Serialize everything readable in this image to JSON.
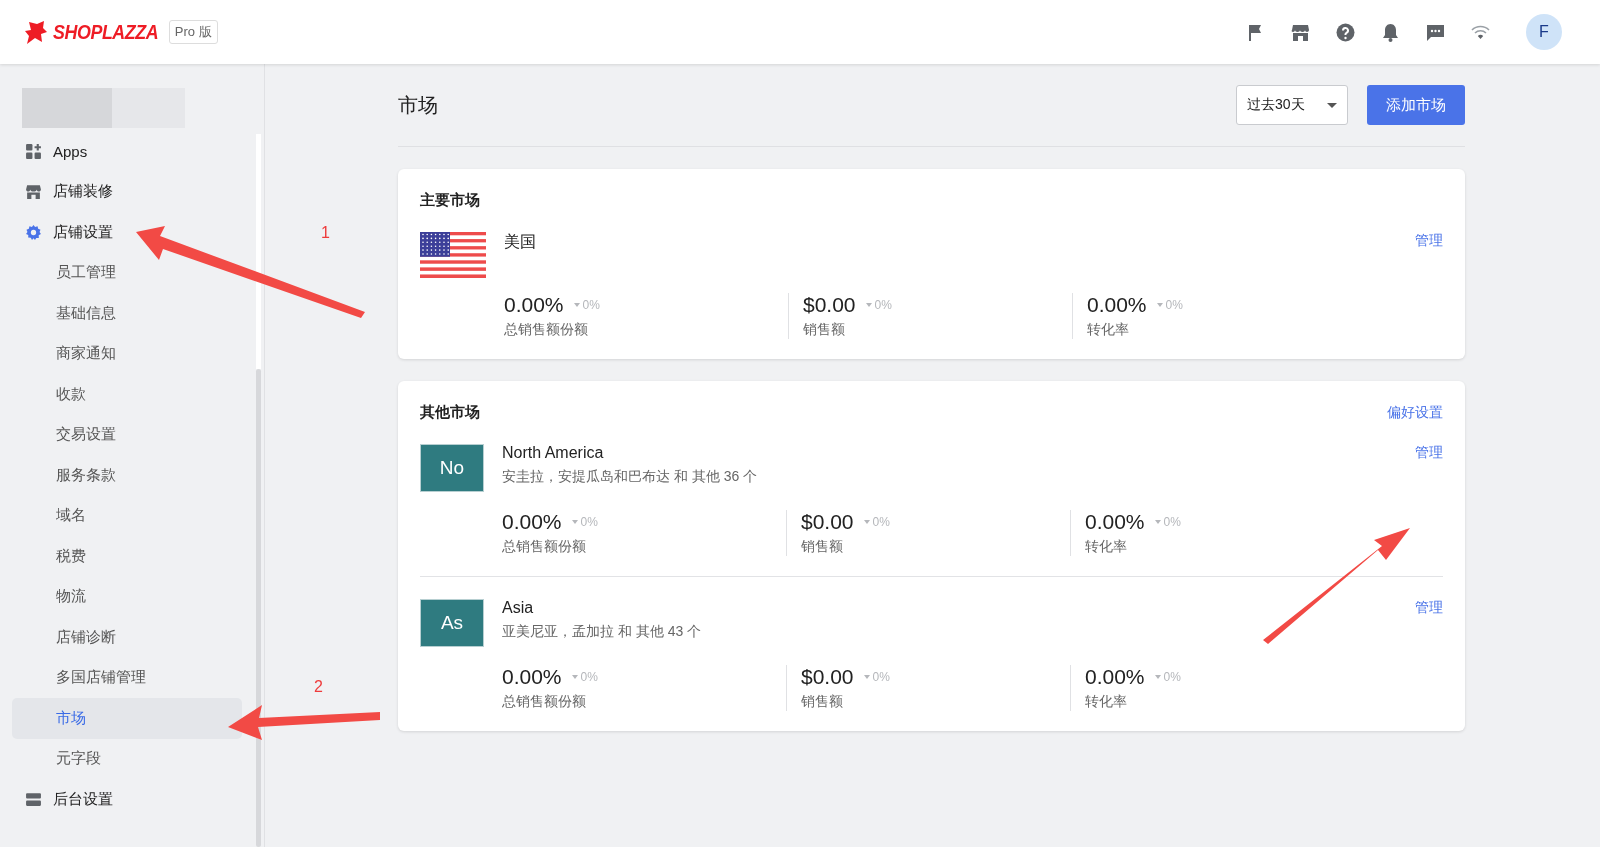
{
  "header": {
    "logo": "SHOPLAZZA",
    "plan_badge": "Pro 版",
    "avatar": "F"
  },
  "sidebar": {
    "items": [
      {
        "label": "Apps",
        "expanded": false
      },
      {
        "label": "店铺装修",
        "expanded": false
      },
      {
        "label": "店铺设置",
        "expanded": true,
        "children": [
          {
            "label": "员工管理",
            "selected": false
          },
          {
            "label": "基础信息",
            "selected": false
          },
          {
            "label": "商家通知",
            "selected": false
          },
          {
            "label": "收款",
            "selected": false
          },
          {
            "label": "交易设置",
            "selected": false
          },
          {
            "label": "服务条款",
            "selected": false
          },
          {
            "label": "域名",
            "selected": false
          },
          {
            "label": "税费",
            "selected": false
          },
          {
            "label": "物流",
            "selected": false
          },
          {
            "label": "店铺诊断",
            "selected": false
          },
          {
            "label": "多国店铺管理",
            "selected": false
          },
          {
            "label": "市场",
            "selected": true
          },
          {
            "label": "元字段",
            "selected": false
          }
        ]
      },
      {
        "label": "后台设置",
        "expanded": false
      }
    ]
  },
  "page": {
    "title": "市场",
    "date_range": "过去30天",
    "add_button": "添加市场"
  },
  "primary_market": {
    "heading": "主要市场",
    "name": "美国",
    "manage": "管理",
    "metrics": [
      {
        "value": "0.00%",
        "change": "0%",
        "label": "总销售额份额"
      },
      {
        "value": "$0.00",
        "change": "0%",
        "label": "销售额"
      },
      {
        "value": "0.00%",
        "change": "0%",
        "label": "转化率"
      }
    ]
  },
  "other_markets": {
    "heading": "其他市场",
    "preferences": "偏好设置",
    "markets": [
      {
        "badge": "No",
        "name": "North America",
        "regions": "安圭拉，安提瓜岛和巴布达 和 其他 36 个",
        "manage": "管理",
        "metrics": [
          {
            "value": "0.00%",
            "change": "0%",
            "label": "总销售额份额"
          },
          {
            "value": "$0.00",
            "change": "0%",
            "label": "销售额"
          },
          {
            "value": "0.00%",
            "change": "0%",
            "label": "转化率"
          }
        ]
      },
      {
        "badge": "As",
        "name": "Asia",
        "regions": "亚美尼亚，孟加拉 和 其他 43 个",
        "manage": "管理",
        "metrics": [
          {
            "value": "0.00%",
            "change": "0%",
            "label": "总销售额份额"
          },
          {
            "value": "$0.00",
            "change": "0%",
            "label": "销售额"
          },
          {
            "value": "0.00%",
            "change": "0%",
            "label": "转化率"
          }
        ]
      }
    ]
  },
  "annotations": [
    {
      "label": "1"
    },
    {
      "label": "2"
    }
  ]
}
